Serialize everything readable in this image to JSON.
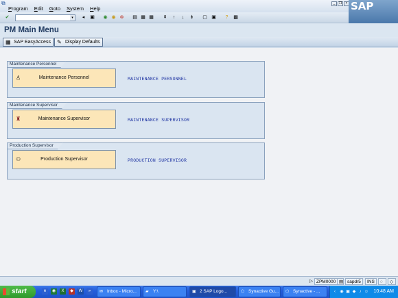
{
  "menubar": {
    "items": [
      "Program",
      "Edit",
      "Goto",
      "System",
      "Help"
    ],
    "window_controls": [
      "minimize",
      "restore",
      "close"
    ]
  },
  "logo": {
    "text": "SAP"
  },
  "toolbar": {
    "command_field_value": "",
    "icons": [
      "enter-icon",
      "save-icon",
      "back-icon",
      "exit-icon",
      "cancel-icon",
      "print-icon",
      "find-icon",
      "find-next-icon",
      "first-page-icon",
      "previous-page-icon",
      "next-page-icon",
      "last-page-icon",
      "new-session-icon",
      "shortcut-icon",
      "help-icon",
      "layout-icon"
    ]
  },
  "title": "PM Main Menu",
  "app_toolbar": {
    "buttons": [
      {
        "label": "SAP EasyAccess",
        "icon": "easy-access-icon"
      },
      {
        "label": "Display Defaults",
        "icon": "display-defaults-icon"
      }
    ]
  },
  "groups": [
    {
      "tab": "Maintenance Personnel",
      "button": "Maintenance Personnel",
      "description": "MAINTENANCE PERSONNEL",
      "icon": "personnel-icon"
    },
    {
      "tab": "Maintenance Supervisor",
      "button": "Maintenance Supervisor",
      "description": "MAINTENANCE SUPERVISOR",
      "icon": "supervisor-icon"
    },
    {
      "tab": "Production Supervisor",
      "button": "Production Supervisor",
      "description": "PRODUCTION SUPERVISOR",
      "icon": "binoculars-icon"
    }
  ],
  "statusbar": {
    "transaction": "ZPM0000",
    "server": "sapdr5",
    "mode": "INS"
  },
  "taskbar": {
    "start": "start",
    "tasks": [
      {
        "label": "Inbox - Micro...",
        "active": false
      },
      {
        "label": "Y:\\",
        "active": false
      },
      {
        "label": "2 SAP Logo...",
        "active": true
      },
      {
        "label": "Synactive Gu...",
        "active": false
      },
      {
        "label": "Synactive - ...",
        "active": false
      }
    ],
    "clock": "10:48 AM"
  },
  "colors": {
    "group_button_bg": "#fce6b8",
    "description_text": "#1a2fa0",
    "title_text": "#233d63"
  }
}
